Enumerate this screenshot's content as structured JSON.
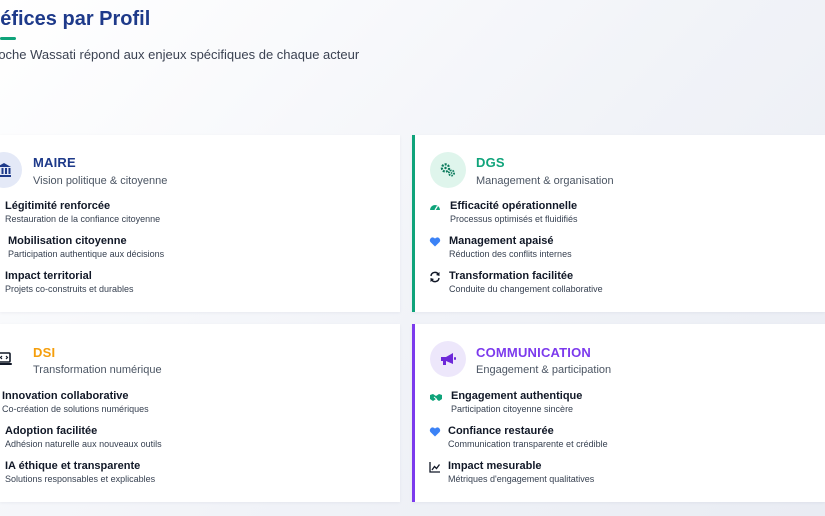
{
  "header": {
    "title": "néfices par Profil",
    "subtitle": "roche Wassati répond aux enjeux spécifiques de chaque acteur"
  },
  "colors": {
    "maire": "#1e3a8a",
    "dgs": "#0fa37a",
    "dsi": "#f59e0b",
    "communication": "#7c3aed"
  },
  "profiles": [
    {
      "id": "maire",
      "title": "MAIRE",
      "subtitle": "Vision politique & citoyenne",
      "icon": "bank-icon",
      "items": [
        {
          "title": "Légitimité renforcée",
          "desc": "Restauration de la confiance citoyenne"
        },
        {
          "title": "Mobilisation citoyenne",
          "desc": "Participation authentique aux décisions"
        },
        {
          "title": "Impact territorial",
          "desc": "Projets co-construits et durables"
        }
      ]
    },
    {
      "id": "dgs",
      "title": "DGS",
      "subtitle": "Management & organisation",
      "icon": "cogs-icon",
      "items": [
        {
          "title": "Efficacité opérationnelle",
          "desc": "Processus optimisés et fluidifiés",
          "icon": "gauge-icon"
        },
        {
          "title": "Management apaisé",
          "desc": "Réduction des conflits internes",
          "icon": "heart-icon"
        },
        {
          "title": "Transformation facilitée",
          "desc": "Conduite du changement collaborative",
          "icon": "sync-icon"
        }
      ]
    },
    {
      "id": "dsi",
      "title": "DSI",
      "subtitle": "Transformation numérique",
      "icon": "laptop-code-icon",
      "items": [
        {
          "title": "Innovation collaborative",
          "desc": "Co-création de solutions numériques"
        },
        {
          "title": "Adoption facilitée",
          "desc": "Adhésion naturelle aux nouveaux outils"
        },
        {
          "title": "IA éthique et transparente",
          "desc": "Solutions responsables et explicables"
        }
      ]
    },
    {
      "id": "communication",
      "title": "COMMUNICATION",
      "subtitle": "Engagement & participation",
      "icon": "megaphone-icon",
      "items": [
        {
          "title": "Engagement authentique",
          "desc": "Participation citoyenne sincère",
          "icon": "handshake-icon"
        },
        {
          "title": "Confiance restaurée",
          "desc": "Communication transparente et crédible",
          "icon": "heart-icon"
        },
        {
          "title": "Impact mesurable",
          "desc": "Métriques d'engagement qualitatives",
          "icon": "chart-line-icon"
        }
      ]
    }
  ]
}
